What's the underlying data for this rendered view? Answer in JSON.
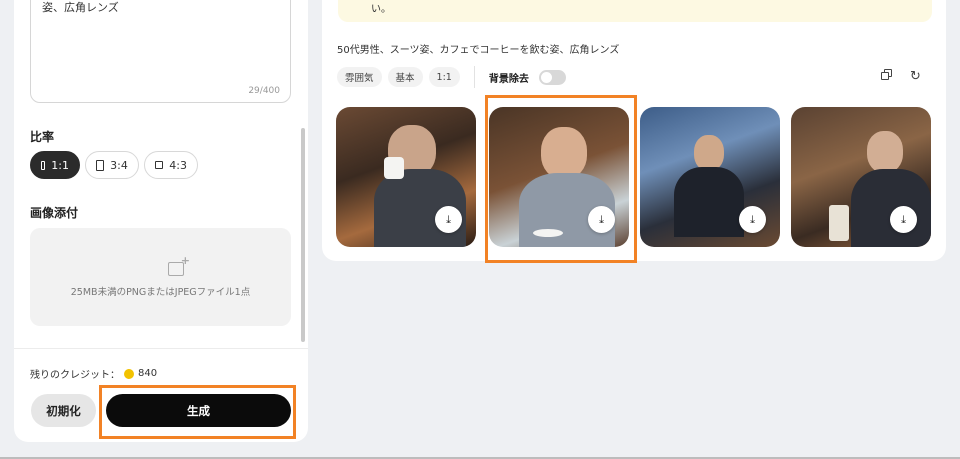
{
  "left_panel": {
    "prompt_text": "姿、広角レンズ",
    "char_count": "29/400",
    "ratio_label": "比率",
    "ratios": [
      {
        "label": "1:1",
        "selected": true
      },
      {
        "label": "3:4",
        "selected": false
      },
      {
        "label": "4:3",
        "selected": false
      }
    ],
    "attach_label": "画像添付",
    "upload_hint": "25MB未満のPNGまたはJPEGファイル1点",
    "credits_label": "残りのクレジット：",
    "credits_value": "840",
    "reset_label": "初期化",
    "generate_label": "生成"
  },
  "right_panel": {
    "notice_text": "い。",
    "prompt_line": "50代男性、スーツ姿、カフェでコーヒーを飲む姿、広角レンズ",
    "chips": [
      "雰囲気",
      "基本",
      "1:1"
    ],
    "bg_removal_label": "背景除去",
    "bg_removal_enabled": false,
    "images": [
      {
        "icon": "download-icon"
      },
      {
        "icon": "download-icon"
      },
      {
        "icon": "download-icon"
      },
      {
        "icon": "download-icon"
      }
    ],
    "highlighted_image_index": 1
  },
  "colors": {
    "highlight": "#f28225",
    "generate_bg": "#0b0b0b",
    "notice_bg": "#fdf9e2",
    "coin": "#f2c200"
  }
}
